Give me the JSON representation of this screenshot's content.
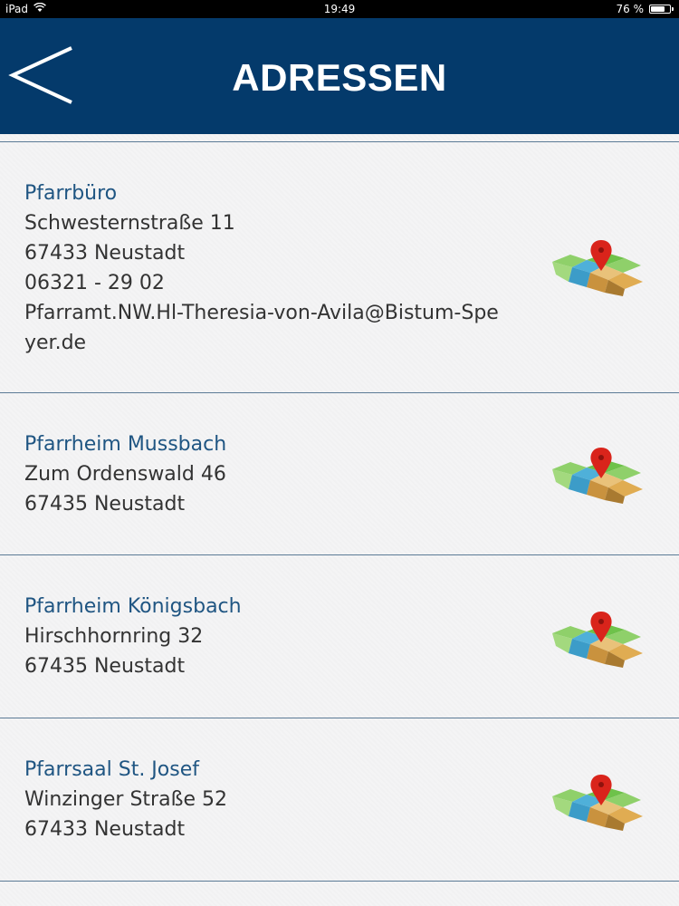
{
  "status_bar": {
    "device": "iPad",
    "time": "19:49",
    "battery": "76 %",
    "battery_level": 0.76
  },
  "header": {
    "title": "ADRESSEN"
  },
  "addresses": [
    {
      "name": "Pfarrbüro",
      "street": "Schwesternstraße 11",
      "city": "67433 Neustadt",
      "phone": "06321 - 29 02",
      "email": "Pfarramt.NW.Hl-Theresia-von-Avila@Bistum-Speyer.de"
    },
    {
      "name": "Pfarrheim Mussbach",
      "street": "Zum Ordenswald 46",
      "city": "67435 Neustadt"
    },
    {
      "name": "Pfarrheim Königsbach",
      "street": "Hirschhornring 32",
      "city": "67435 Neustadt"
    },
    {
      "name": "Pfarrsaal St. Josef",
      "street": "Winzinger Straße 52",
      "city": "67433 Neustadt"
    }
  ],
  "icons": {
    "back": "chevron-left-icon",
    "map": "map-pin-icon"
  },
  "colors": {
    "header_bg": "#043a6b",
    "title_text": "#ffffff",
    "item_title": "#1f5582",
    "item_text": "#333333",
    "divider": "#5c7b96"
  }
}
